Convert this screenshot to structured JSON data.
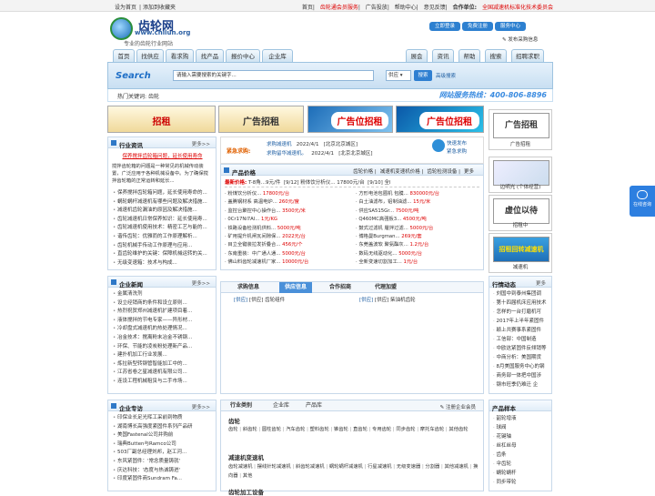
{
  "topbar": {
    "left": [
      "设为首页",
      "添加到收藏夹"
    ],
    "right": [
      "首页",
      "齿轮通会员服务",
      "广告投放",
      "帮助中心",
      "意见反馈",
      "合作单位:",
      "全国减速机标准化技术委员会"
    ]
  },
  "logo": {
    "name": "齿轮网",
    "url": "www.chilun.org",
    "slogan": "专业的齿轮行业网站"
  },
  "quick": [
    "立即登录",
    "免费注册",
    "服务中心"
  ],
  "publish": "发布采购信息",
  "nav": [
    "首页",
    "找供应",
    "看求购",
    "找产品",
    "报价中心",
    "企业库",
    "展会",
    "资讯",
    "帮助",
    "搜索",
    "招聘求职"
  ],
  "search": {
    "logo": "Search",
    "placeholder": "请输入需要搜索的关键字...",
    "select": "供应",
    "button": "搜索",
    "advanced": "高级搜索"
  },
  "hot": {
    "label": "热门关键词:",
    "kw": "齿轮",
    "hotline": "网站服务热线：400-806-8896"
  },
  "banners": [
    "招租",
    "广告招租",
    "广告位招租",
    "广告位招租"
  ],
  "news": {
    "title": "行业资讯",
    "more": "更多>>",
    "headline": "保养搅拌齿轮箱问题，延长使用寿命",
    "intro": "搅拌齿轮箱的问题是一种常见的机械传动装置，广泛应用于各种机械设备中。为了确保搅拌齿轮箱的正常运转和延长...",
    "items": [
      "保养搅拌齿轮箱问题，延长使用寿命的...",
      "蜗轮蜗杆减速机有哪些问题及解决措施...",
      "减速机齿轮漏油的原因及解决措施...",
      "齿轮减速机日常保养知识：延长使用寿...",
      "齿轮减速机使用技术：精密工艺与能的...",
      "谐传齿轮：优雅而的工作原理解析...",
      "齿轮机械手传动工作原理与应用...",
      "直齿轮维护的关键：保障机械运转的关...",
      "无级变速箱：技术与构成..."
    ]
  },
  "urgent": {
    "label": "紧急求购:",
    "items": [
      {
        "t": "求购减速机",
        "d": "2022/4/1",
        "c": "[北京北京城区]"
      },
      {
        "t": "求购留华减速机。",
        "d": "2022/4/1",
        "c": "[北京北京城区]"
      }
    ],
    "btn1": "快速发布",
    "btn2": "紧急求购"
  },
  "price": {
    "title": "产品价格",
    "tabs": [
      "齿轮价格",
      "减速机变速机价格",
      "齿轮检测设备",
      "更多"
    ],
    "latest": "最新价格:",
    "ticker": [
      "T-8角...9元/件",
      "[9/12] 粉体饮分析仪... 17800元/台",
      "[9/10] 全l"
    ],
    "left": [
      [
        "粉煤饮分析仪...",
        "17800元/台"
      ],
      [
        "盖腾钢材系 高温电炉...",
        "260元/度"
      ],
      [
        "监控台聚控中心操作台...",
        "3500元/米"
      ],
      [
        "0Cr17Ni7Al...",
        "1元/KG"
      ],
      [
        "铁路设备检测机供料...",
        "5000元/吨"
      ],
      [
        "矿用提升机闸瓦间隙保...",
        "2022元/台"
      ],
      [
        "目立全键装拉发折叠合...",
        "456元/个"
      ],
      [
        "东南重装：中广通人通...",
        "5000元/台"
      ],
      [
        "佛山料齿轮减速机厂家...",
        "10000元/台"
      ]
    ],
    "right": [
      [
        "方形电池包圈机 包膜...",
        "830000元/台"
      ],
      [
        "白土油滤布，铝制油滤...",
        "15元/米"
      ],
      [
        "供应SA515Gr...",
        "7500元/吨"
      ],
      [
        "Q460MC高强板3...",
        "4500元/吨"
      ],
      [
        "鼓式过滤机 履拌过滤...",
        "5000元/台"
      ],
      [
        "博格曼Burgman...",
        "269元/套"
      ],
      [
        "东莞盖波软 聚氨酯灰...",
        "1.2元/台"
      ],
      [
        "数码无线驱动化...",
        "5000元/台"
      ],
      [
        "全新变速切割加工...",
        "1元/台"
      ]
    ]
  },
  "sideads": [
    {
      "img": "广告招租",
      "cap": "广告招租"
    },
    {
      "img": "",
      "cap": "边明光 (个体经营)"
    },
    {
      "img": "虚位以待",
      "cap": "招租中"
    },
    {
      "img": "招租回转减速机",
      "cap": "减速机"
    }
  ],
  "company": {
    "title": "企业新闻",
    "more": "更多>>",
    "items": [
      "金属清洗剂",
      "设立经销商的条件和设立原则...",
      "热烈祝贺郑州减速机扩建项目着...",
      "液体搅拌的节电专家——异形材...",
      "冷却盘式减速机的热处理情况...",
      "冶金技术：搅离粉末冶金不锈钢...",
      "环保、节能的凌炭粉处理新产品...",
      "建扑机加工行业发展...",
      "炼拉新型转钢管智能加工中的...",
      "江苏省卷之星减速机有限公司...",
      "连设工程机械租赁与二手市场..."
    ]
  },
  "buysell": {
    "tabs": [
      "求购信息",
      "供应信息",
      "合作招商",
      "代理加盟"
    ],
    "l": "[供应] 齿轮组件",
    "r": "[供应] 柴油机齿轮"
  },
  "ranking": {
    "title": "行情动态",
    "more": "更多",
    "items": [
      "刘国中到泰州集团调",
      "第十四届机床应用技术",
      "怎样的一台打磨机可",
      "2017年上半年紧固件",
      "颖上共赛事系紧固件",
      "工信部：中国制造",
      "中欧这紧固件反倾销等",
      "中商分析：美国期货",
      "8月美国服务中心的钢",
      "商务部一体把中国涉",
      "钢市旺季仍难迁 企"
    ]
  },
  "special": {
    "title": "企业专访",
    "more": "更多>>",
    "items": [
      "印保业长足光晖工采前到物质",
      "湖南博长高强度紧固件系列产品研",
      "美国Fastenal公司并购前",
      "瑞典Butten与Ramco公司",
      "503厂副总经理刘邦，赵工河...",
      "东风紧固件：'常念质量铸就'",
      "庆达科技：'态度与热诚铸进'",
      "印度紧固件商Sundram Fa..."
    ]
  },
  "category": {
    "tabs": [
      "行业类别",
      "企业库",
      "产品库"
    ],
    "register": "注册企业会员",
    "g1": {
      "title": "齿轮",
      "items": [
        "齿轮",
        "斜齿轮",
        "圆柱齿轮",
        "汽车齿轮",
        "塑料齿轮",
        "锥齿轮",
        "直齿轮",
        "专用齿轮",
        "同步齿轮",
        "摩托车齿轮",
        "其他齿轮"
      ]
    },
    "g2": {
      "title": "减速机变速机",
      "items": [
        "齿轮减速机",
        "摆线针轮减速机",
        "斜齿轮减速机",
        "蜗轮蜗杆减速机",
        "行星减速机",
        "无级变速器",
        "分割器",
        "其他减速机",
        "换向器",
        "其他"
      ]
    },
    "g3": {
      "title": "齿轮加工设备"
    }
  },
  "samples": {
    "title": "产品样本",
    "items": [
      "韶轮增液",
      "球阀",
      "花键轴",
      "丝杠丝母",
      "齿条",
      "伞齿轮",
      "蜗轮蜗杆",
      "同步带轮"
    ]
  }
}
